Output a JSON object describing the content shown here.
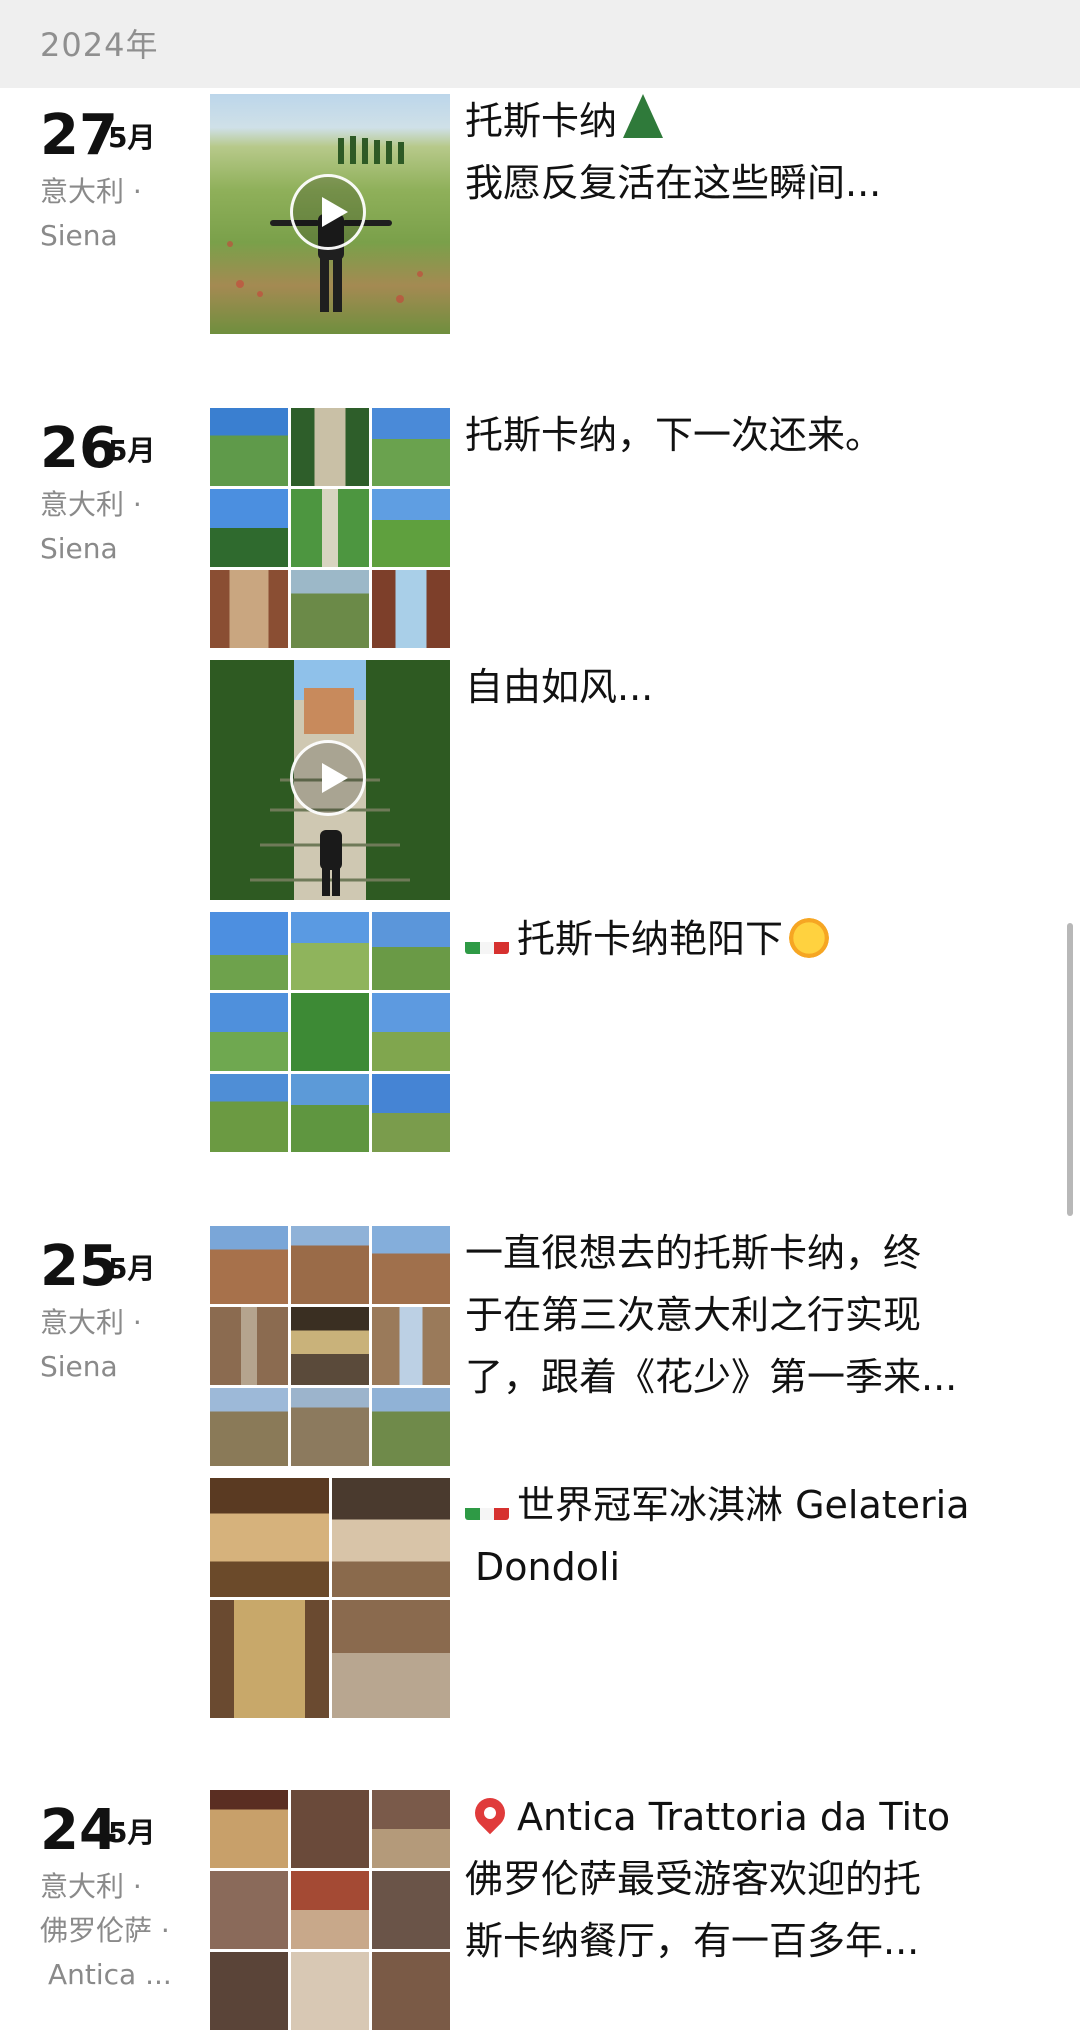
{
  "header": {
    "year": "2024年"
  },
  "entries": [
    {
      "day": "27",
      "month": "5月",
      "location": [
        "意大利 ·",
        "Siena"
      ],
      "posts": [
        {
          "type": "video",
          "text": [
            "托斯卡纳",
            "我愿反复活在这些瞬间..."
          ],
          "emoji": "tree-icon"
        }
      ]
    },
    {
      "day": "26",
      "month": "5月",
      "location": [
        "意大利 ·",
        "Siena"
      ],
      "posts": [
        {
          "type": "grid9",
          "text": [
            "托斯卡纳，下一次还来。"
          ]
        },
        {
          "type": "video",
          "text": [
            "自由如风..."
          ]
        },
        {
          "type": "grid9",
          "text": [
            "托斯卡纳艳阳下"
          ],
          "emoji": "sun-icon",
          "flag": "italy-flag-icon"
        }
      ]
    },
    {
      "day": "25",
      "month": "5月",
      "location": [
        "意大利 ·",
        "Siena"
      ],
      "posts": [
        {
          "type": "grid9",
          "text": [
            "一直很想去的托斯卡纳，终",
            "于在第三次意大利之行实现",
            "了，跟着《花少》第一季来..."
          ]
        },
        {
          "type": "grid4",
          "text": [
            "世界冠军冰淇淋 Gelateria",
            "Dondoli"
          ],
          "flag": "italy-flag-icon"
        }
      ]
    },
    {
      "day": "24",
      "month": "5月",
      "location": [
        "意大利 ·",
        "佛罗伦萨 ·",
        "Antica ..."
      ],
      "posts": [
        {
          "type": "grid9",
          "text": [
            "Antica Trattoria da Tito",
            "佛罗伦萨最受游客欢迎的托",
            "斯卡纳餐厅，有一百多年..."
          ],
          "pin": "location-pin-icon"
        }
      ]
    }
  ],
  "colors": {
    "header_bg": "#efefef",
    "secondary_text": "#8a8a8a",
    "primary_text": "#111111"
  }
}
